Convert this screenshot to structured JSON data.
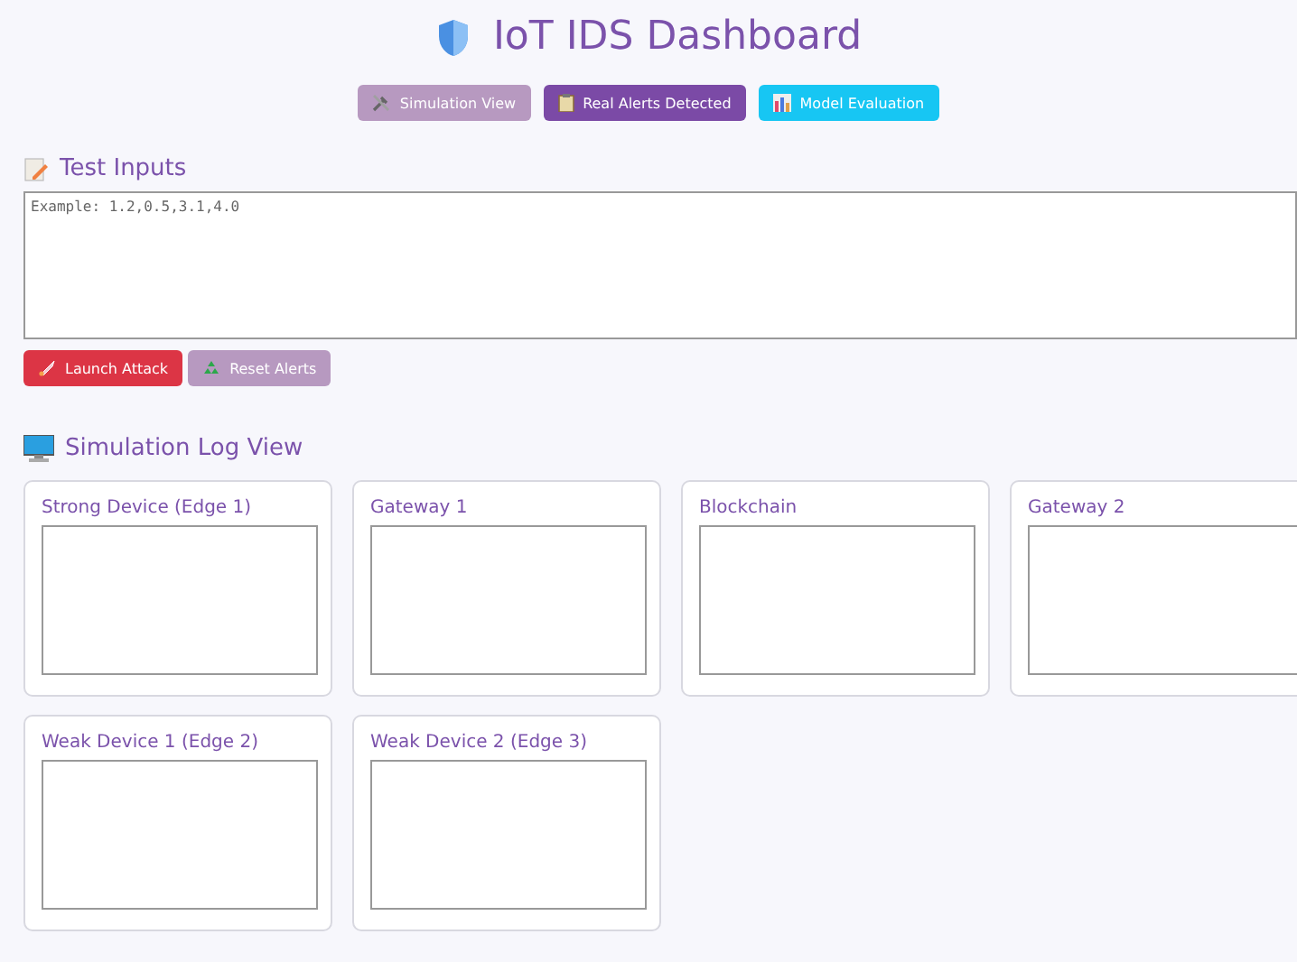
{
  "header": {
    "title": "IoT IDS Dashboard"
  },
  "nav_buttons": [
    {
      "label": "Simulation View",
      "kind": "tools",
      "color": "#b799c0"
    },
    {
      "label": "Real Alerts Detected",
      "kind": "clipboard",
      "color": "#7b4aa6"
    },
    {
      "label": "Model Evaluation",
      "kind": "chart",
      "color": "#17c6f3"
    }
  ],
  "test_inputs": {
    "heading": "Test Inputs",
    "placeholder": "Example: 1.2,0.5,3.1,4.0",
    "buttons": [
      {
        "label": "Launch Attack",
        "kind": "rocket",
        "color": "#dc3545"
      },
      {
        "label": "Reset Alerts",
        "kind": "recycle",
        "color": "#b799c0"
      }
    ]
  },
  "simulation": {
    "heading": "Simulation Log View",
    "cards": [
      {
        "title": "Strong Device (Edge 1)"
      },
      {
        "title": "Gateway 1"
      },
      {
        "title": "Blockchain"
      },
      {
        "title": "Gateway 2"
      },
      {
        "title": "Weak Device 1 (Edge 2)"
      },
      {
        "title": "Weak Device 2 (Edge 3)"
      }
    ]
  }
}
